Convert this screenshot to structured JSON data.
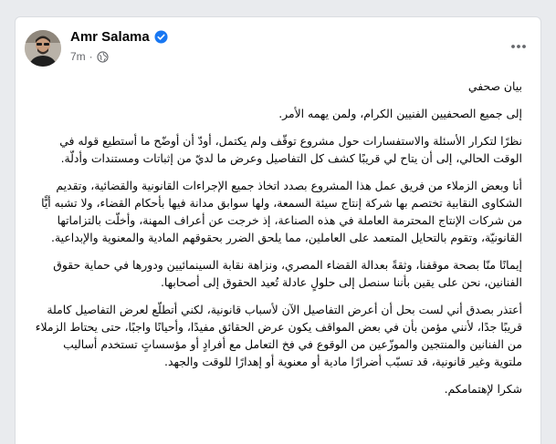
{
  "post": {
    "author": "Amr Salama",
    "timestamp": "7m",
    "paragraphs": [
      "بيان صحفي",
      "إلى جميع الصحفيين الفنيين الكرام، ولمن يهمه الأمر.",
      "نظرًا لتكرار الأسئلة والاستفسارات حول مشروع توقّف ولم يكتمل، أودّ أن أوضّح ما أستطيع قوله في الوقت الحالي، إلى أن يتاح لي قريبًا كشف كل التفاصيل وعرض ما لديّ من إثباتات ومستندات وأدلّة.",
      "أنا وبعض الزملاء من فريق عمل هذا المشروع بصدد اتخاذ جميع الإجراءات القانونية والقضائية، وتقديم الشكاوى النقابية تختصم بها شركة إنتاج سيئة السمعة، ولها سوابق مدانة فيها بأحكام القضاء، ولا تشبه أيًّا من شركات الإنتاج المحترمة العاملة في هذه الصناعة، إذ خرجت عن أعراف المهنة، وأخلّت بالتزاماتها القانونيّة، وتقوم بالتحايل المتعمد على العاملين، مما يلحق الضرر بحقوقهم المادية والمعنوية والإبداعية.",
      "إيمانًا منّا بصحة موقفنا، وثقةً بعدالة القضاء المصري، ونزاهة نقابة السينمائيين ودورها في حماية حقوق الفنانين، نحن على يقين بأننا سنصل إلى حلولٍ عادلة تُعيد الحقوق إلى أصحابها.",
      "أعتذر بصدق أني لست بحل أن أعرض التفاصيل الآن لأسباب قانونية، لكني أتطلّع لعرض التفاصيل كاملة قريبًا جدًا، لأنني مؤمن بأن في بعض المواقف يكون عرض الحقائق مفيدًا، وأحيانًا واجبًا، حتى يحتاط الزملاء من الفنانين والمنتجين والموزّعين من الوقوع في فخ التعامل مع أفرادٍ أو مؤسساتٍ تستخدم أساليب ملتوية وغير قانونية، قد تسبّب أضرارًا مادية أو معنوية أو إهدارًا للوقت والجهد.",
      "شكرا لإهتمامكم."
    ]
  },
  "icons": {
    "verified": "verified-badge-icon",
    "privacy": "globe-icon",
    "more": "more-options-icon"
  },
  "colors": {
    "verified_blue": "#1877f2",
    "meta_gray": "#65676b",
    "text": "#050505",
    "page_bg": "#e9ebee"
  }
}
